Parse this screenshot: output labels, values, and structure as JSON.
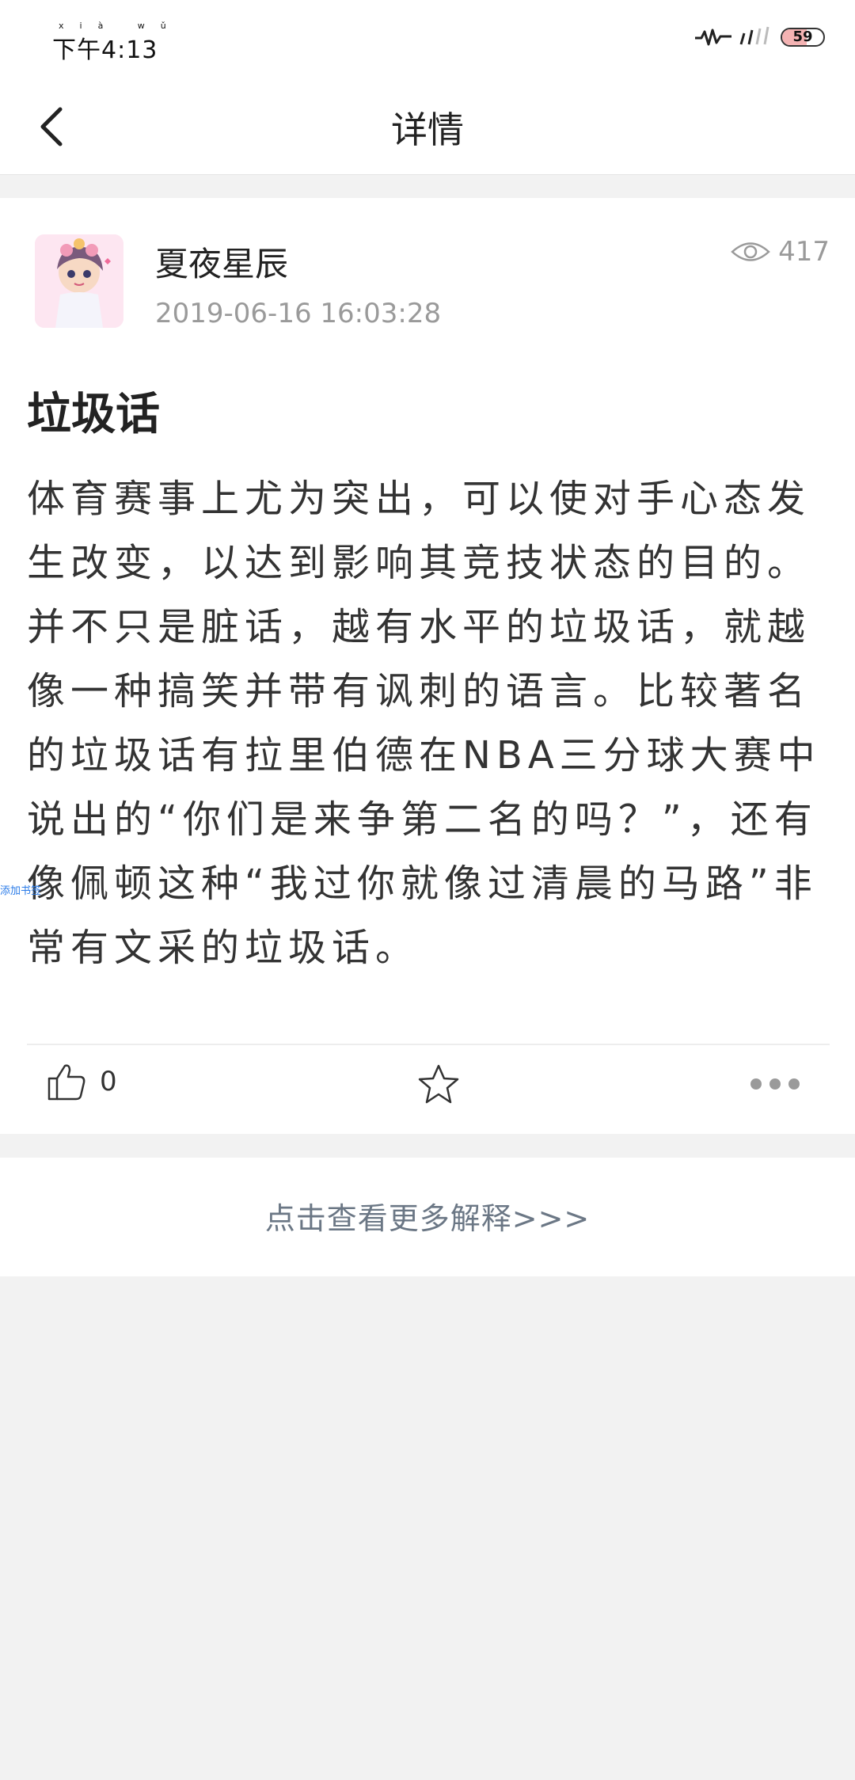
{
  "status_bar": {
    "time": "下午4:13",
    "time_pinyin": "xià wǔ",
    "battery_level": 59,
    "battery_label": "59"
  },
  "nav": {
    "title": "详情",
    "back_icon": "chevron-left-icon"
  },
  "post": {
    "author": "夏夜星辰",
    "timestamp": "2019-06-16 16:03:28",
    "views": "417",
    "title": "垃圾话",
    "body": "体育赛事上尤为突出，可以使对手心态发生改变，以达到影响其竞技状态的目的。并不只是脏话，越有水平的垃圾话，就越像一种搞笑并带有讽刺的语言。比较著名的垃圾话有拉里伯德在NBA三分球大赛中说出的“你们是来争第二名的吗？”，还有像佩顿这种“我过你就像过清晨的马路”非常有文采的垃圾话。",
    "side_tag": "添加书签",
    "like_count": "0"
  },
  "actions": {
    "like_icon": "thumb-up-icon",
    "favorite_icon": "star-icon",
    "more_icon": "more-dots-icon"
  },
  "more_link": "点击查看更多解释>>>",
  "colors": {
    "background": "#f2f2f2",
    "card": "#ffffff",
    "muted_text": "#9a9a9a",
    "link_text": "#6b7785"
  }
}
